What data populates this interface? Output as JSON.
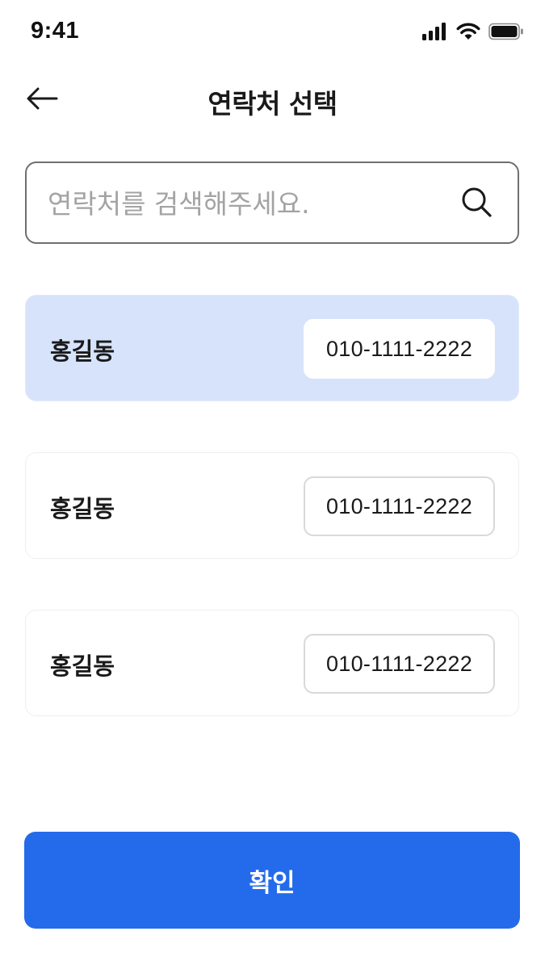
{
  "status_bar": {
    "time": "9:41",
    "icons": [
      "signal-icon",
      "wifi-icon",
      "battery-icon"
    ]
  },
  "header": {
    "title": "연락처 선택",
    "back_icon": "arrow-left-icon"
  },
  "search": {
    "placeholder": "연락처를 검색해주세요.",
    "value": "",
    "icon": "search-icon"
  },
  "contacts": [
    {
      "name": "홍길동",
      "phone": "010-1111-2222",
      "selected": true
    },
    {
      "name": "홍길동",
      "phone": "010-1111-2222",
      "selected": false
    },
    {
      "name": "홍길동",
      "phone": "010-1111-2222",
      "selected": false
    }
  ],
  "confirm_button": {
    "label": "확인"
  },
  "colors": {
    "accent": "#246beb",
    "selected_background": "#d7e3fb",
    "text": "#1a1a1a",
    "placeholder": "#a3a3a3",
    "border": "#6f6f6f"
  }
}
